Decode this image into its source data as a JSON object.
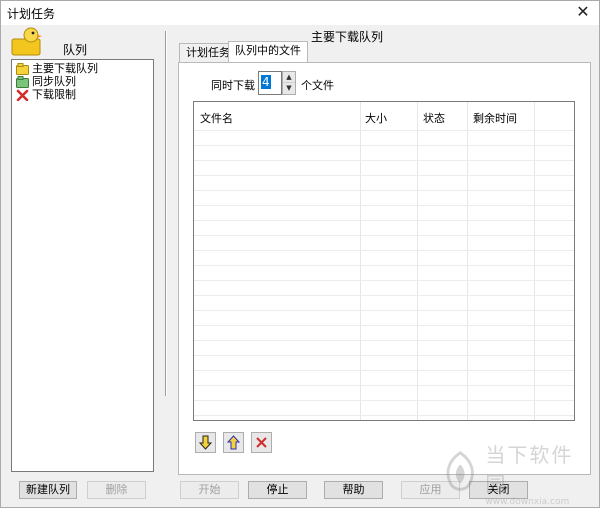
{
  "window": {
    "title": "计划任务",
    "close_glyph": "✕"
  },
  "left": {
    "heading": "队列",
    "icon": "duck-folder-icon",
    "tree": [
      {
        "label": "主要下载队列",
        "icon": "download-queue-icon",
        "color": "#f4d33a"
      },
      {
        "label": "同步队列",
        "icon": "sync-queue-icon",
        "color": "#5aa85a"
      },
      {
        "label": "下载限制",
        "icon": "limit-icon",
        "color": "#d22d2d"
      }
    ]
  },
  "right": {
    "section_title": "主要下载队列",
    "tabs": [
      {
        "label": "计划任务",
        "active": false
      },
      {
        "label": "队列中的文件",
        "active": true
      }
    ],
    "concurrent": {
      "label": "同时下载",
      "value": "4",
      "suffix": "个文件"
    },
    "table": {
      "columns": [
        "文件名",
        "大小",
        "状态",
        "剩余时间"
      ],
      "rows": []
    },
    "toolbar": {
      "move_down_icon": "arrow-down-icon",
      "move_up_icon": "arrow-up-icon",
      "remove_icon": "delete-x-icon"
    }
  },
  "buttons": {
    "new_queue": "新建队列",
    "delete": "删除",
    "start": "开始",
    "stop": "停止",
    "help": "帮助",
    "apply": "应用",
    "close": "关闭"
  },
  "watermark": {
    "cn": "当下软件园",
    "en": "www.downxia.com"
  }
}
